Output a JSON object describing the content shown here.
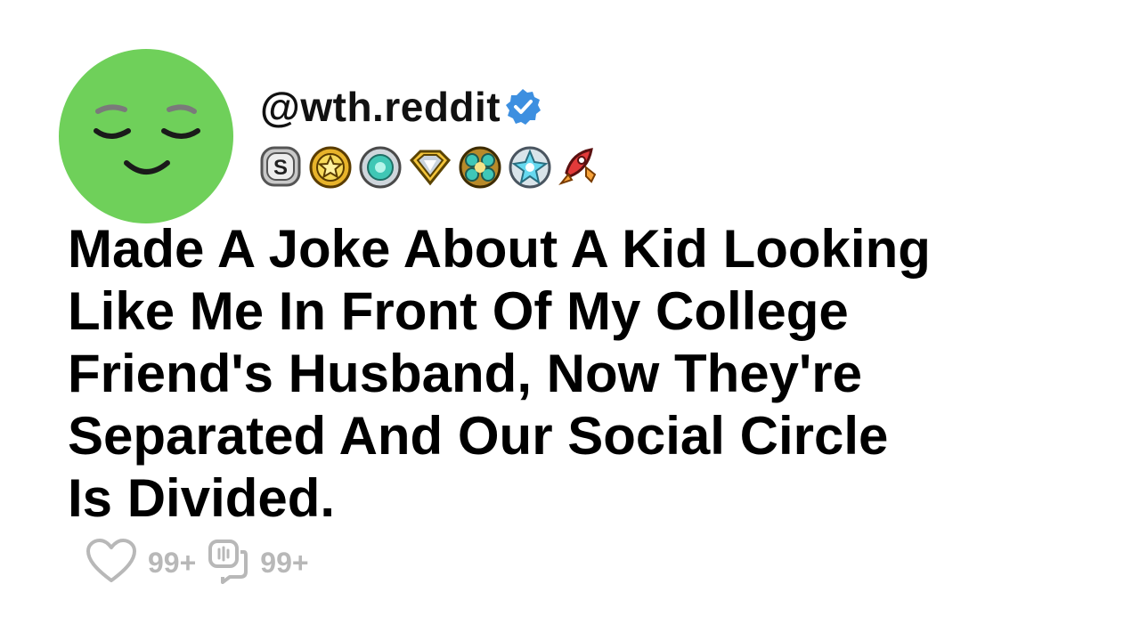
{
  "post": {
    "username": "@wth.reddit",
    "verified": true,
    "title_lines": [
      "Made A Joke About A Kid Looking",
      "Like Me In Front Of My College",
      "Friend's Husband, Now They're",
      "Separated And Our Social Circle",
      "Is Divided."
    ],
    "likes": "99+",
    "comments": "99+"
  },
  "icons": {
    "avatar": "smiling-face-avatar",
    "verified": "verified-check-icon",
    "badges": [
      "s-badge-icon",
      "star-badge-icon",
      "gem-badge-icon",
      "diamond-badge-icon",
      "cluster-badge-icon",
      "crystal-badge-icon",
      "rocket-badge-icon"
    ],
    "like": "heart-icon",
    "comment": "comment-icon"
  },
  "colors": {
    "avatar_bg": "#6fd05a",
    "verified": "#3d8fe0",
    "muted": "#b8b8b8",
    "text": "#000000"
  }
}
